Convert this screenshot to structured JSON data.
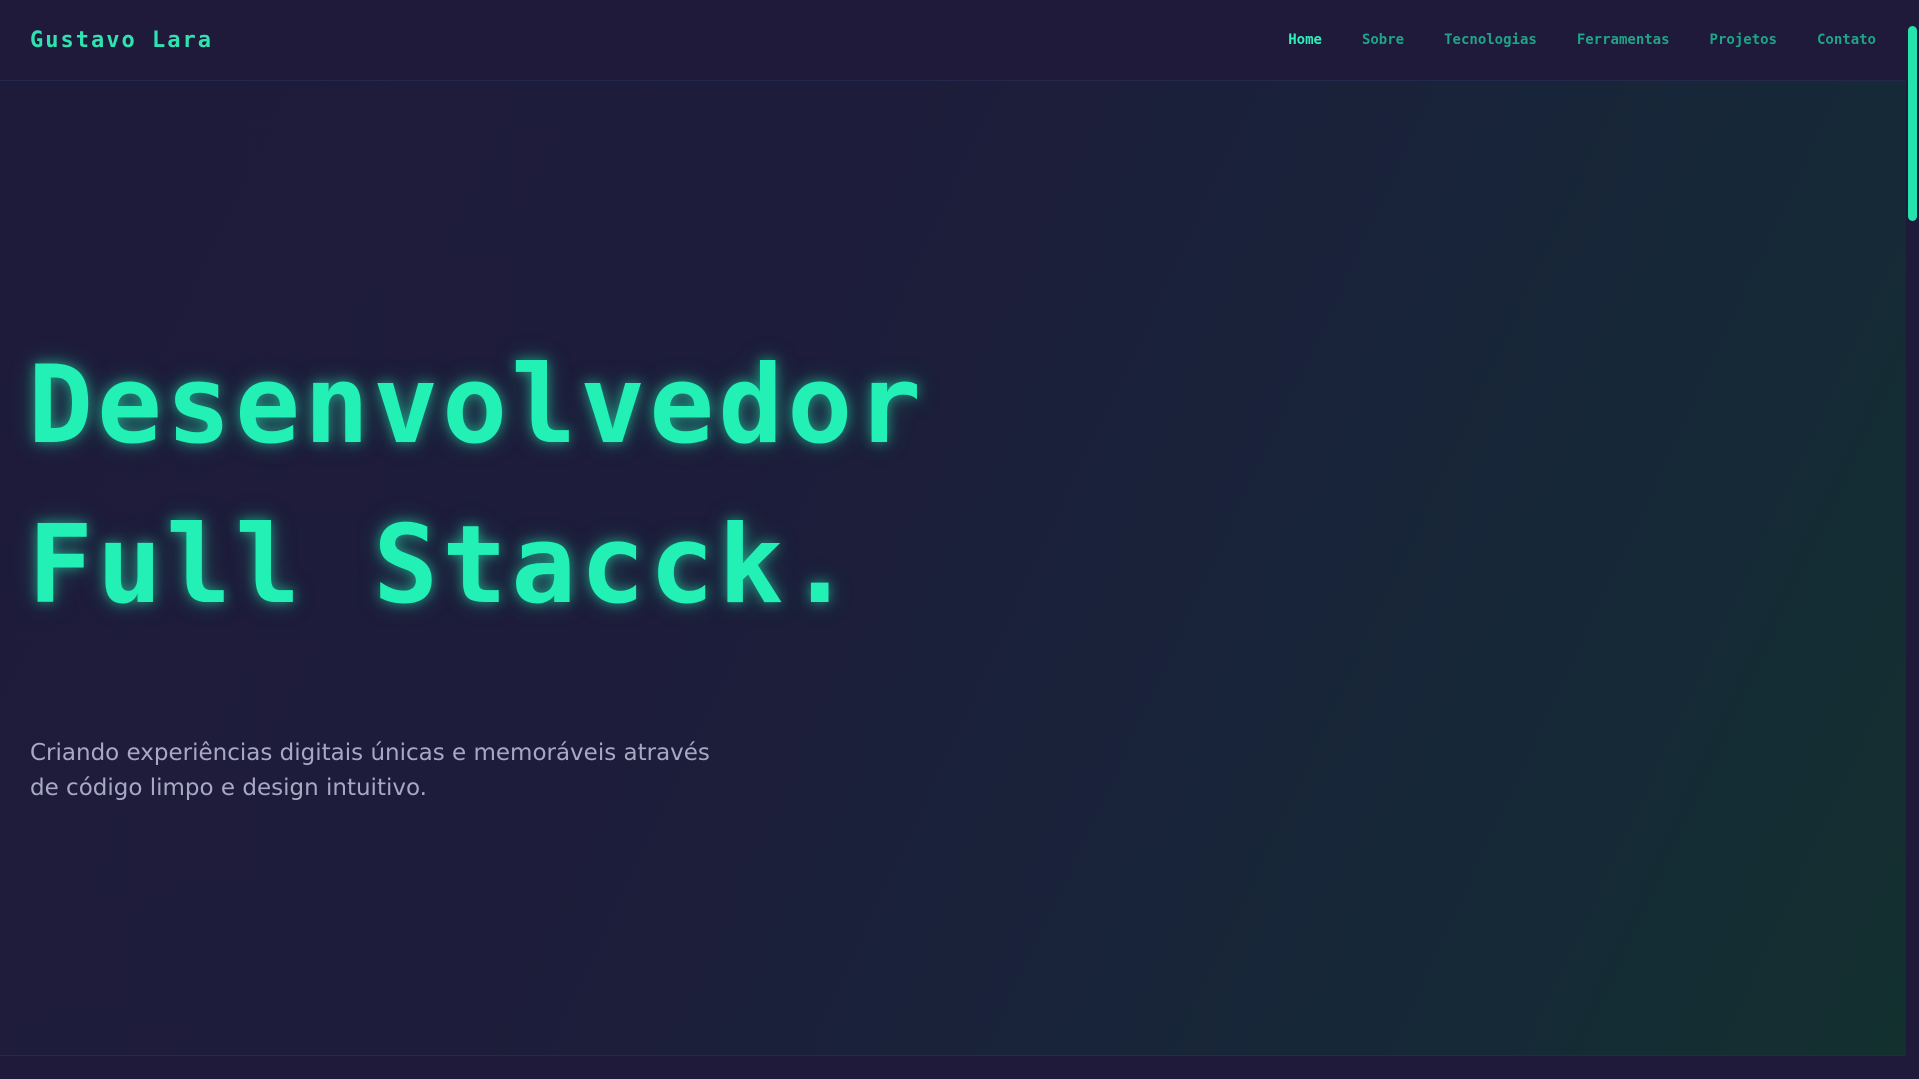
{
  "colors": {
    "accent": "#22f0b4",
    "nav_link": "#1fa48a",
    "nav_active": "#2ff0bd",
    "background": "#1e1a38",
    "subtitle_text": "#a9a8c3"
  },
  "header": {
    "brand": "Gustavo Lara",
    "nav": {
      "items": [
        {
          "label": "Home",
          "active": true
        },
        {
          "label": "Sobre",
          "active": false
        },
        {
          "label": "Tecnologias",
          "active": false
        },
        {
          "label": "Ferramentas",
          "active": false
        },
        {
          "label": "Projetos",
          "active": false
        },
        {
          "label": "Contato",
          "active": false
        }
      ]
    }
  },
  "hero": {
    "title_line1": "Desenvolvedor",
    "title_line2": "Full Stacck.",
    "subtitle": "Criando experiências digitais únicas e memoráveis através de código limpo e design intuitivo."
  }
}
